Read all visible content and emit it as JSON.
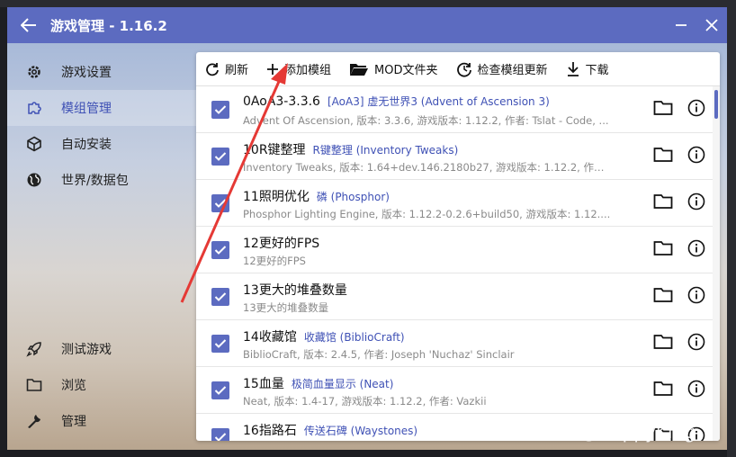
{
  "window": {
    "title": "游戏管理 - 1.16.2"
  },
  "sidebar": {
    "items": [
      {
        "label": "游戏设置"
      },
      {
        "label": "模组管理"
      },
      {
        "label": "自动安装"
      },
      {
        "label": "世界/数据包"
      }
    ],
    "bottom_items": [
      {
        "label": "测试游戏"
      },
      {
        "label": "浏览"
      },
      {
        "label": "管理"
      }
    ]
  },
  "toolbar": {
    "refresh": "刷新",
    "add_mod": "添加模组",
    "mod_folder": "MOD文件夹",
    "check_updates": "检查模组更新",
    "download": "下载"
  },
  "mods": [
    {
      "name": "0AoA3-3.3.6",
      "tag": "[AoA3] 虚无世界3 (Advent of Ascension 3)",
      "desc": "Advent Of Ascension, 版本: 3.3.6, 游戏版本: 1.12.2, 作者: Tslat - Code, ..."
    },
    {
      "name": "10R键整理",
      "tag": "R键整理 (Inventory Tweaks)",
      "desc": "Inventory Tweaks, 版本: 1.64+dev.146.2180b27, 游戏版本: 1.12.2, 作者..."
    },
    {
      "name": "11照明优化",
      "tag": "磷 (Phosphor)",
      "desc": "Phosphor Lighting Engine, 版本: 1.12.2-0.2.6+build50, 游戏版本: 1.12...."
    },
    {
      "name": "12更好的FPS",
      "tag": "",
      "desc": "12更好的FPS"
    },
    {
      "name": "13更大的堆叠数量",
      "tag": "",
      "desc": "13更大的堆叠数量"
    },
    {
      "name": "14收藏馆",
      "tag": "收藏馆 (BiblioCraft)",
      "desc": "BiblioCraft, 版本: 2.4.5, 作者: Joseph 'Nuchaz' Sinclair"
    },
    {
      "name": "15血量",
      "tag": "极简血量显示 (Neat)",
      "desc": "Neat, 版本: 1.4-17, 游戏版本: 1.12.2, 作者: Vazkii"
    },
    {
      "name": "16指路石",
      "tag": "传送石碑 (Waystones)",
      "desc": ""
    }
  ],
  "watermark": "知乎 @HappyKing",
  "colors": {
    "accent": "#5c6bc0",
    "arrow": "#e53935"
  }
}
